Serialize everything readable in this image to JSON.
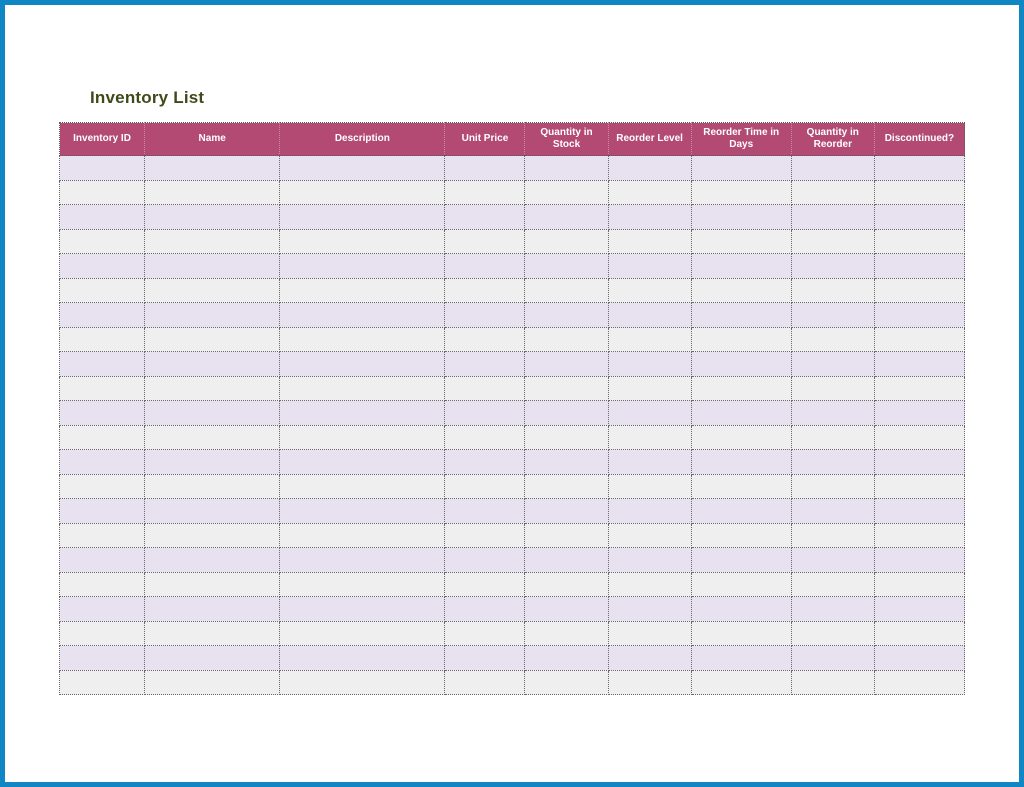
{
  "title": "Inventory List",
  "columns": [
    "Inventory ID",
    "Name",
    "Description",
    "Unit Price",
    "Quantity in Stock",
    "Reorder Level",
    "Reorder Time in Days",
    "Quantity in Reorder",
    "Discontinued?"
  ],
  "row_count": 22,
  "rows": [
    [
      "",
      "",
      "",
      "",
      "",
      "",
      "",
      "",
      ""
    ],
    [
      "",
      "",
      "",
      "",
      "",
      "",
      "",
      "",
      ""
    ],
    [
      "",
      "",
      "",
      "",
      "",
      "",
      "",
      "",
      ""
    ],
    [
      "",
      "",
      "",
      "",
      "",
      "",
      "",
      "",
      ""
    ],
    [
      "",
      "",
      "",
      "",
      "",
      "",
      "",
      "",
      ""
    ],
    [
      "",
      "",
      "",
      "",
      "",
      "",
      "",
      "",
      ""
    ],
    [
      "",
      "",
      "",
      "",
      "",
      "",
      "",
      "",
      ""
    ],
    [
      "",
      "",
      "",
      "",
      "",
      "",
      "",
      "",
      ""
    ],
    [
      "",
      "",
      "",
      "",
      "",
      "",
      "",
      "",
      ""
    ],
    [
      "",
      "",
      "",
      "",
      "",
      "",
      "",
      "",
      ""
    ],
    [
      "",
      "",
      "",
      "",
      "",
      "",
      "",
      "",
      ""
    ],
    [
      "",
      "",
      "",
      "",
      "",
      "",
      "",
      "",
      ""
    ],
    [
      "",
      "",
      "",
      "",
      "",
      "",
      "",
      "",
      ""
    ],
    [
      "",
      "",
      "",
      "",
      "",
      "",
      "",
      "",
      ""
    ],
    [
      "",
      "",
      "",
      "",
      "",
      "",
      "",
      "",
      ""
    ],
    [
      "",
      "",
      "",
      "",
      "",
      "",
      "",
      "",
      ""
    ],
    [
      "",
      "",
      "",
      "",
      "",
      "",
      "",
      "",
      ""
    ],
    [
      "",
      "",
      "",
      "",
      "",
      "",
      "",
      "",
      ""
    ],
    [
      "",
      "",
      "",
      "",
      "",
      "",
      "",
      "",
      ""
    ],
    [
      "",
      "",
      "",
      "",
      "",
      "",
      "",
      "",
      ""
    ],
    [
      "",
      "",
      "",
      "",
      "",
      "",
      "",
      "",
      ""
    ],
    [
      "",
      "",
      "",
      "",
      "",
      "",
      "",
      "",
      ""
    ]
  ]
}
